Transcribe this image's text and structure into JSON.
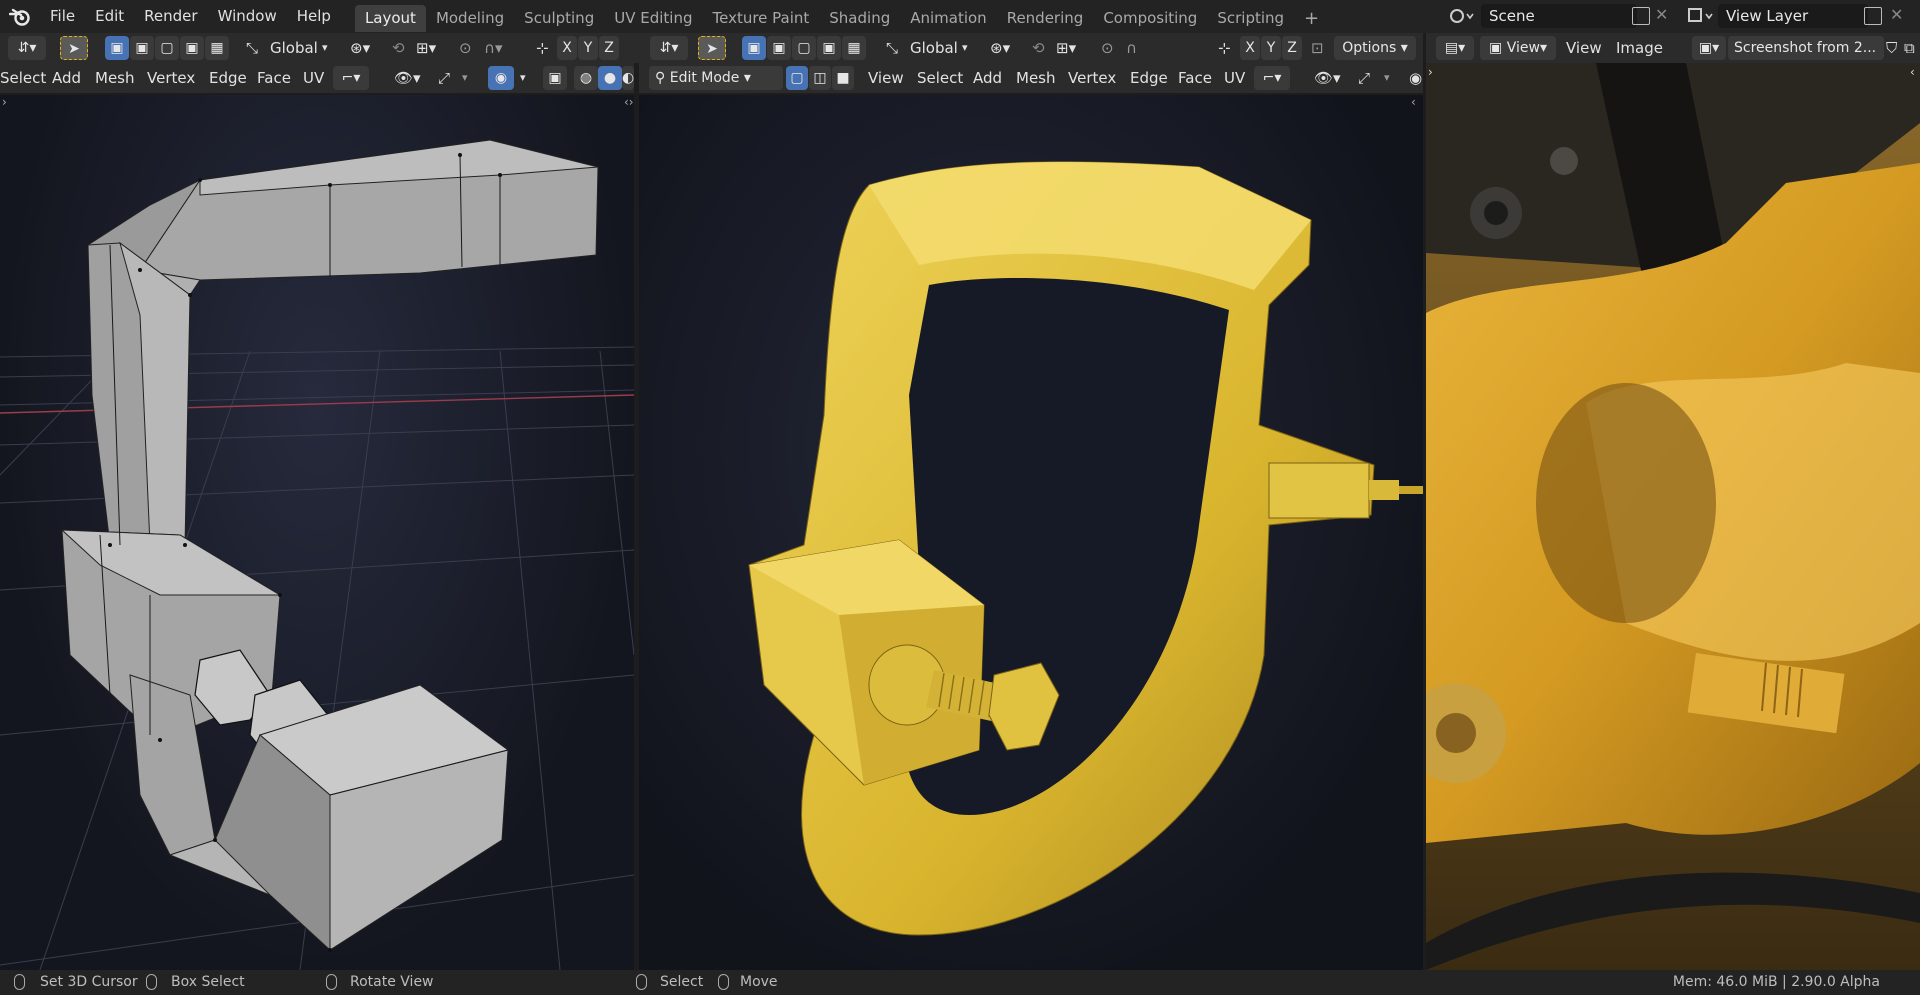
{
  "app": {
    "logo_icon": "blender-logo-icon"
  },
  "menu": [
    "File",
    "Edit",
    "Render",
    "Window",
    "Help"
  ],
  "workspaces": [
    {
      "label": "Layout",
      "active": true
    },
    {
      "label": "Modeling"
    },
    {
      "label": "Sculpting"
    },
    {
      "label": "UV Editing"
    },
    {
      "label": "Texture Paint"
    },
    {
      "label": "Shading"
    },
    {
      "label": "Animation"
    },
    {
      "label": "Rendering"
    },
    {
      "label": "Compositing"
    },
    {
      "label": "Scripting"
    }
  ],
  "add_workspace": "+",
  "scene": {
    "label": "Scene"
  },
  "view_layer": {
    "label": "View Layer"
  },
  "left_view": {
    "orientation": "Global",
    "axes": [
      "X",
      "Y",
      "Z"
    ],
    "menus": [
      "Select",
      "Add",
      "Mesh",
      "Vertex",
      "Edge",
      "Face",
      "UV"
    ]
  },
  "mid_view": {
    "orientation": "Global",
    "axes": [
      "X",
      "Y",
      "Z"
    ],
    "options": "Options",
    "mode": "Edit Mode",
    "menus": [
      "View",
      "Select",
      "Add",
      "Mesh",
      "Vertex",
      "Edge",
      "Face",
      "UV"
    ]
  },
  "image_editor": {
    "menus": [
      "View",
      "View",
      "Image"
    ],
    "image_name": "Screenshot from 2..."
  },
  "status": {
    "left": [
      "Set 3D Cursor",
      "Box Select",
      "Rotate View"
    ],
    "mid": [
      "Select",
      "Move"
    ],
    "right": "Mem: 46.0 MiB | 2.90.0 Alpha"
  },
  "colors": {
    "accent": "#4772b3",
    "mesh_yellow": "#e3c23a",
    "photo_yellow": "#e0a830"
  }
}
